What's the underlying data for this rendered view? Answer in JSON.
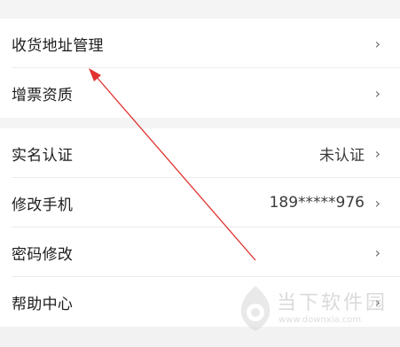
{
  "sections": [
    {
      "rows": [
        {
          "label": "收货地址管理",
          "value": "",
          "chevron": "›"
        },
        {
          "label": "增票资质",
          "value": "",
          "chevron": "›"
        }
      ]
    },
    {
      "rows": [
        {
          "label": "实名认证",
          "value": "未认证",
          "chevron": "›"
        },
        {
          "label": "修改手机",
          "value": "189*****976",
          "chevron": "›"
        },
        {
          "label": "密码修改",
          "value": "",
          "chevron": "›"
        },
        {
          "label": "帮助中心",
          "value": "",
          "chevron": "›"
        }
      ]
    }
  ],
  "watermark": {
    "title": "当下软件园",
    "url": "www.downxia.com"
  },
  "colors": {
    "arrow": "#e0322f",
    "background": "#f4f4f4",
    "row_background": "#ffffff"
  },
  "icons": [
    "chevron-right-icon",
    "red-annotation-arrow",
    "downxia-logo-icon"
  ]
}
